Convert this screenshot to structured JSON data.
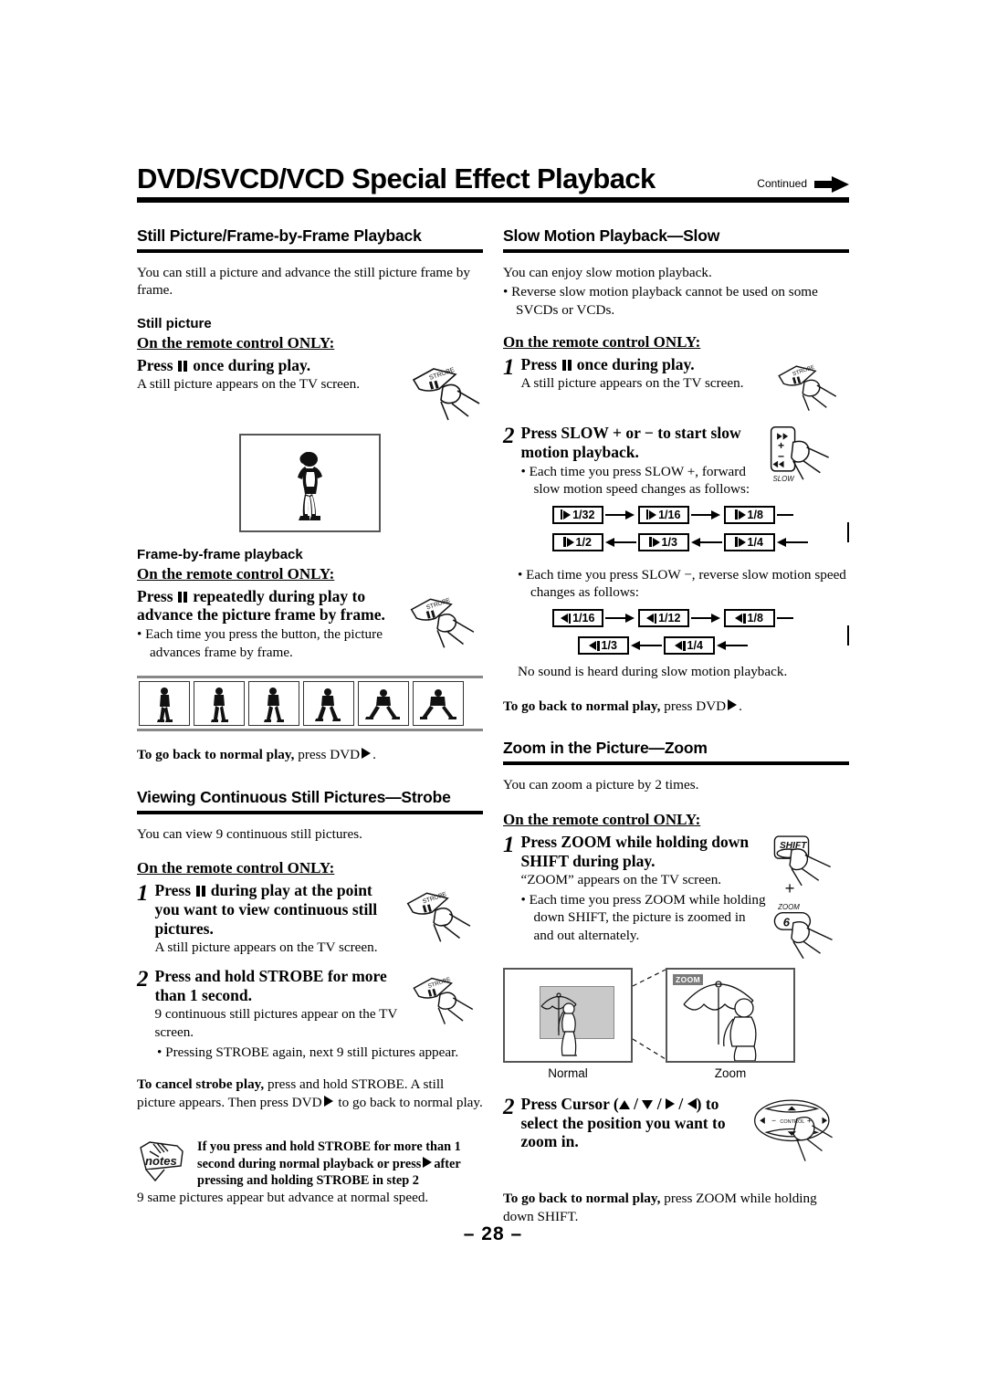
{
  "header": {
    "title": "DVD/SVCD/VCD Special Effect Playback",
    "continued_label": "Continued",
    "continued_icon": "arrow-right-solid-icon"
  },
  "left_column": {
    "section1": {
      "heading": "Still Picture/Frame-by-Frame Playback",
      "intro": "You can still a picture and advance the still picture frame by frame.",
      "subhead_still": "Still picture",
      "remote_only": "On the remote control ONLY:",
      "instruction_still": "Press ❙❙ once during play.",
      "instruction_still_pre": "Press",
      "instruction_still_post": "once during play.",
      "still_result": "A still picture appears on the TV screen.",
      "tv_art": "baseball-pitcher-still-illustration",
      "button_art_label": "STROBE",
      "subhead_frame": "Frame-by-frame playback",
      "remote_only_2": "On the remote control ONLY:",
      "instruction_frame_pre": "Press",
      "instruction_frame_post": "repeatedly during play to advance the picture frame by frame.",
      "frame_bullet": "Each time you press the button, the picture advances frame by frame.",
      "film_strip_art": "six-frame-pitching-sequence",
      "back_to_normal_bold": "To go back to normal play,",
      "back_to_normal_rest": "press DVD"
    },
    "section2": {
      "heading": "Viewing Continuous Still Pictures—Strobe",
      "intro": "You can view 9 continuous still pictures.",
      "remote_only": "On the remote control ONLY:",
      "step1_num": "1",
      "step1_pre": "Press",
      "step1_post": "during play at the point you want to view continuous still pictures.",
      "step1_result": "A still picture appears on the TV screen.",
      "step2_num": "2",
      "step2_text": "Press and hold STROBE for more than 1 second.",
      "step2_result": "9 continuous still pictures appear on the TV screen.",
      "step2_bullet": "Pressing STROBE again, next 9 still pictures appear.",
      "cancel_bold": "To cancel strobe play,",
      "cancel_rest_1": "press and hold STROBE. A still picture appears. Then press DVD",
      "cancel_rest_2": "to go back to normal play.",
      "notes_icon_label": "notes",
      "notes_bold_1": "If you press and hold STROBE for more than 1 second during normal playback or press",
      "notes_bold_2": "after pressing and holding STROBE in step 2",
      "notes_plain": "9 same pictures appear but advance at normal speed."
    }
  },
  "right_column": {
    "section3": {
      "heading": "Slow Motion Playback—Slow",
      "intro": "You can enjoy slow motion playback.",
      "intro_bullet": "Reverse slow motion playback cannot be used on some SVCDs or VCDs.",
      "remote_only": "On the remote control ONLY:",
      "step1_num": "1",
      "step1_pre": "Press",
      "step1_post": "once during play.",
      "step1_result": "A still picture appears on the TV screen.",
      "step2_num": "2",
      "step2_text": "Press SLOW + or − to start slow motion playback.",
      "step2_bullet": "Each time you press SLOW +, forward slow motion speed changes as follows:",
      "slow_button_label": "SLOW",
      "forward_speeds": [
        "1/32",
        "1/16",
        "1/8",
        "1/4",
        "1/3",
        "1/2"
      ],
      "reverse_bullet": "Each time you press SLOW −, reverse slow motion speed changes as follows:",
      "reverse_speeds": [
        "1/16",
        "1/12",
        "1/8",
        "1/4",
        "1/3"
      ],
      "no_sound": "No sound is heard during slow motion playback.",
      "back_to_normal_bold": "To go back to normal play,",
      "back_to_normal_rest": "press DVD"
    },
    "section4": {
      "heading": "Zoom in the Picture—Zoom",
      "intro": "You can zoom a picture by 2 times.",
      "remote_only": "On the remote control ONLY:",
      "step1_num": "1",
      "step1_text": "Press ZOOM while holding down SHIFT during play.",
      "step1_result": "“ZOOM” appears on the TV screen.",
      "step1_bullet": "Each time you press ZOOM while holding down SHIFT, the picture is zoomed in and out alternately.",
      "shift_button_label": "SHIFT",
      "plus_label": "+",
      "zoom_button_label": "ZOOM",
      "zoom_button_number": "6",
      "compare_normal_caption": "Normal",
      "compare_zoom_caption": "Zoom",
      "zoom_badge": "ZOOM",
      "step2_num": "2",
      "step2_pre": "Press Cursor (",
      "step2_post": ") to select the position you want to zoom in.",
      "control_label": "CONTROL",
      "control_minus": "−",
      "control_plus": "+",
      "back_to_normal_bold": "To go back to normal play,",
      "back_to_normal_rest": "press ZOOM while holding down SHIFT."
    }
  },
  "footer": {
    "page_number": "– 28 –"
  }
}
